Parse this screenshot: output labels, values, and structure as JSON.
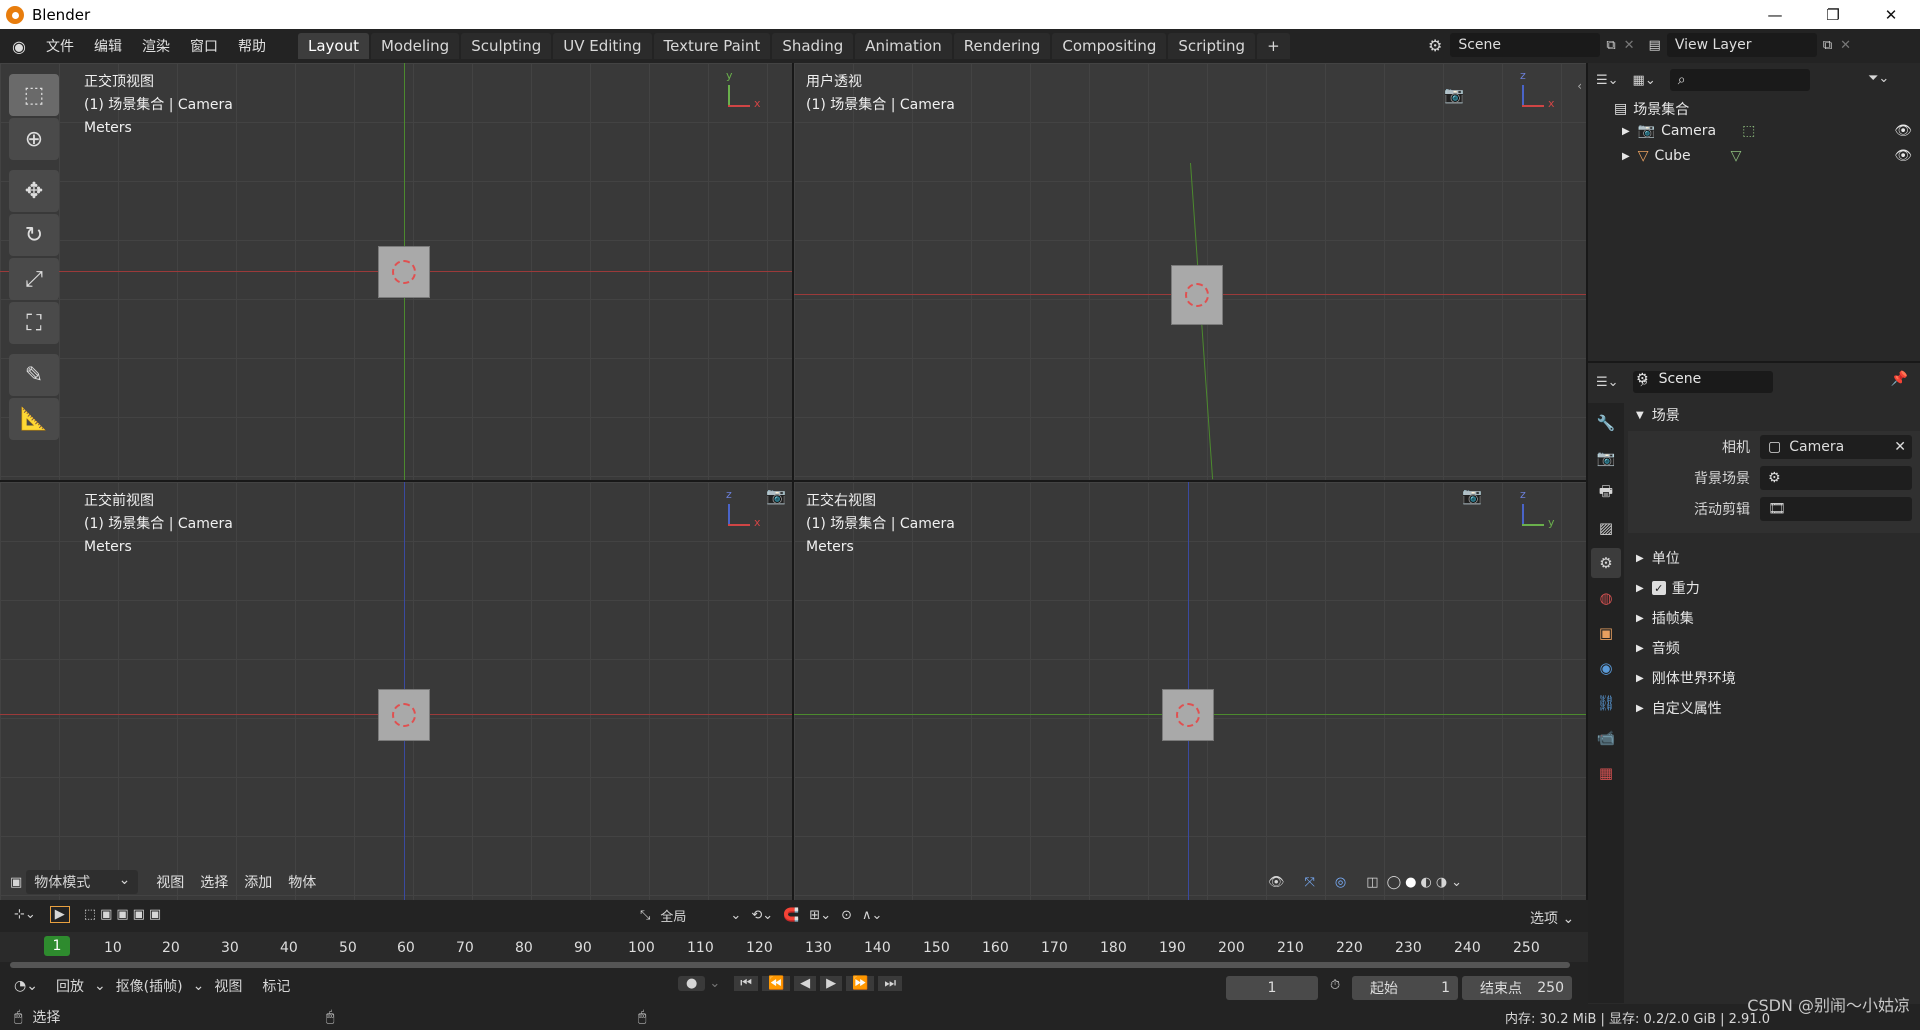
{
  "window": {
    "title": "Blender",
    "minimize": "—",
    "restore": "❐",
    "close": "✕"
  },
  "menu": [
    "文件",
    "编辑",
    "渲染",
    "窗口",
    "帮助"
  ],
  "workspaces": [
    "Layout",
    "Modeling",
    "Sculpting",
    "UV Editing",
    "Texture Paint",
    "Shading",
    "Animation",
    "Rendering",
    "Compositing",
    "Scripting"
  ],
  "add_workspace": "+",
  "scene_field": "Scene",
  "view_layer_field": "View Layer",
  "viewports": {
    "top_left": {
      "view": "正交顶视图",
      "collection": "(1) 场景集合 | Camera",
      "units": "Meters",
      "axis_a": "y",
      "axis_b": "x"
    },
    "top_right": {
      "view": "用户透视",
      "collection": "(1) 场景集合 | Camera",
      "axis_a": "z",
      "axis_b": "x"
    },
    "bottom_left": {
      "view": "正交前视图",
      "collection": "(1) 场景集合 | Camera",
      "units": "Meters",
      "axis_a": "z",
      "axis_b": "x"
    },
    "bottom_right": {
      "view": "正交右视图",
      "collection": "(1) 场景集合 | Camera",
      "units": "Meters",
      "axis_a": "z",
      "axis_b": "y"
    }
  },
  "viewport_header": {
    "mode": "物体模式",
    "view": "视图",
    "select": "选择",
    "add": "添加",
    "object": "物体"
  },
  "tool_header": {
    "transform_orientation": "全局",
    "options": "选项"
  },
  "outliner": {
    "root": "场景集合",
    "items": [
      {
        "label": "Camera"
      },
      {
        "label": "Cube"
      }
    ]
  },
  "properties": {
    "scene_name": "Scene",
    "panel_scene": "场景",
    "camera_label": "相机",
    "camera_value": "Camera",
    "background_label": "背景场景",
    "active_clip_label": "活动剪辑",
    "collapsed_panels": [
      "单位",
      "重力",
      "插帧集",
      "音频",
      "刚体世界环境",
      "自定义属性"
    ]
  },
  "timeline": {
    "current_frame_badge": "1",
    "ticks": [
      "10",
      "20",
      "30",
      "40",
      "50",
      "60",
      "70",
      "80",
      "90",
      "100",
      "110",
      "120",
      "130",
      "140",
      "150",
      "160",
      "170",
      "180",
      "190",
      "200",
      "210",
      "220",
      "230",
      "240",
      "250"
    ],
    "playback": "回放",
    "keying": "抠像(插帧)",
    "view": "视图",
    "marker": "标记",
    "current_frame": "1",
    "start_label": "起始",
    "start_value": "1",
    "end_label": "结束点",
    "end_value": "250"
  },
  "status": {
    "select": "选择",
    "memory": "内存: 30.2 MiB | 显存: 0.2/2.0 GiB | 2.91.0",
    "watermark": "CSDN @别闹～小姑凉"
  },
  "colors": {
    "x_axis": "#9b3a3a",
    "y_axis": "#4c8a2e",
    "z_axis": "#3a4aa0",
    "accent_blue": "#4772b3",
    "frame_green": "#2e8b2e"
  }
}
